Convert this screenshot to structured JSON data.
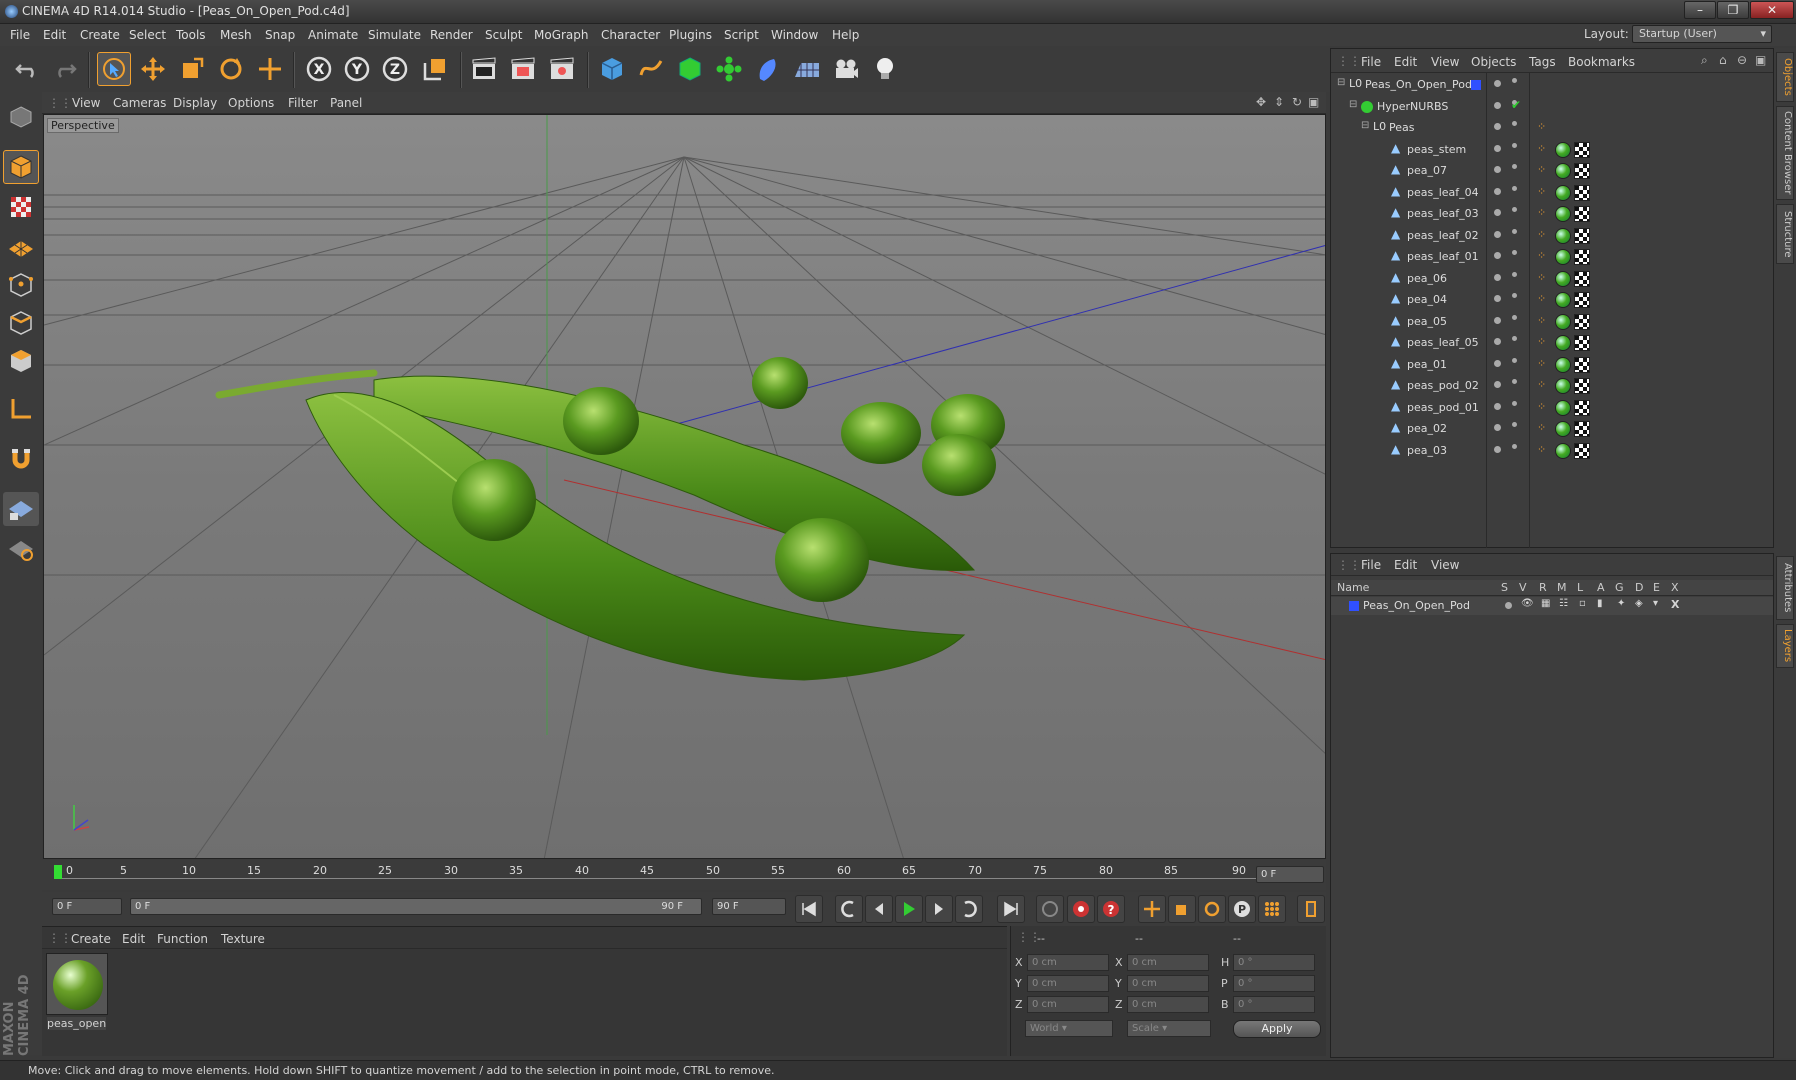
{
  "window": {
    "title": "CINEMA 4D R14.014 Studio - [Peas_On_Open_Pod.c4d]",
    "buttons": [
      "–",
      "❐",
      "✕"
    ]
  },
  "menu": [
    "File",
    "Edit",
    "Create",
    "Select",
    "Tools",
    "Mesh",
    "Snap",
    "Animate",
    "Simulate",
    "Render",
    "Sculpt",
    "MoGraph",
    "Character",
    "Plugins",
    "Script",
    "Window",
    "Help"
  ],
  "layout": {
    "label": "Layout:",
    "value": "Startup (User)"
  },
  "viewport": {
    "menu": [
      "View",
      "Cameras",
      "Display",
      "Options",
      "Filter",
      "Panel"
    ],
    "label": "Perspective"
  },
  "timeline": {
    "ticks": [
      "0",
      "5",
      "10",
      "15",
      "20",
      "25",
      "30",
      "35",
      "40",
      "45",
      "50",
      "55",
      "60",
      "65",
      "70",
      "75",
      "80",
      "85",
      "90"
    ],
    "end_field": "0 F"
  },
  "transport": {
    "current": "0 F",
    "range_start": "0 F",
    "range_end": "90 F",
    "max": "90 F"
  },
  "material": {
    "menu": [
      "Create",
      "Edit",
      "Function",
      "Texture"
    ],
    "item": "peas_open"
  },
  "coords": {
    "header": "--",
    "header2": "--",
    "header3": "--",
    "x_pos": "0 cm",
    "y_pos": "0 cm",
    "z_pos": "0 cm",
    "x_size": "0 cm",
    "y_size": "0 cm",
    "z_size": "0 cm",
    "h": "0 °",
    "p": "0 °",
    "b": "0 °",
    "world": "World",
    "scale": "Scale",
    "apply": "Apply",
    "labels": {
      "x": "X",
      "y": "Y",
      "z": "Z",
      "h": "H",
      "p": "P",
      "b": "B"
    }
  },
  "status": "Move: Click and drag to move elements. Hold down SHIFT to quantize movement / add to the selection in point mode, CTRL to remove.",
  "objects": {
    "menu": [
      "File",
      "Edit",
      "View",
      "Objects",
      "Tags",
      "Bookmarks"
    ],
    "root": "Peas_On_Open_Pod",
    "hypernurbs": "HyperNURBS",
    "group": "Peas",
    "items": [
      "peas_stem",
      "pea_07",
      "peas_leaf_04",
      "peas_leaf_03",
      "peas_leaf_02",
      "peas_leaf_01",
      "pea_06",
      "pea_04",
      "pea_05",
      "peas_leaf_05",
      "pea_01",
      "peas_pod_02",
      "peas_pod_01",
      "pea_02",
      "pea_03"
    ]
  },
  "layers": {
    "menu": [
      "File",
      "Edit",
      "View"
    ],
    "header": "Name",
    "cols": [
      "S",
      "V",
      "R",
      "M",
      "L",
      "A",
      "G",
      "D",
      "E",
      "X"
    ],
    "row": "Peas_On_Open_Pod"
  },
  "sidetabs": [
    "Objects",
    "Content Browser",
    "Structure",
    "Attributes",
    "Layers"
  ],
  "brand": "MAXON CINEMA 4D",
  "colors": {
    "accent_orange": "#f0a030",
    "axis_x": "#c03030",
    "axis_y": "#30b030",
    "axis_z": "#3030c0",
    "layer_blue": "#3050ff"
  }
}
